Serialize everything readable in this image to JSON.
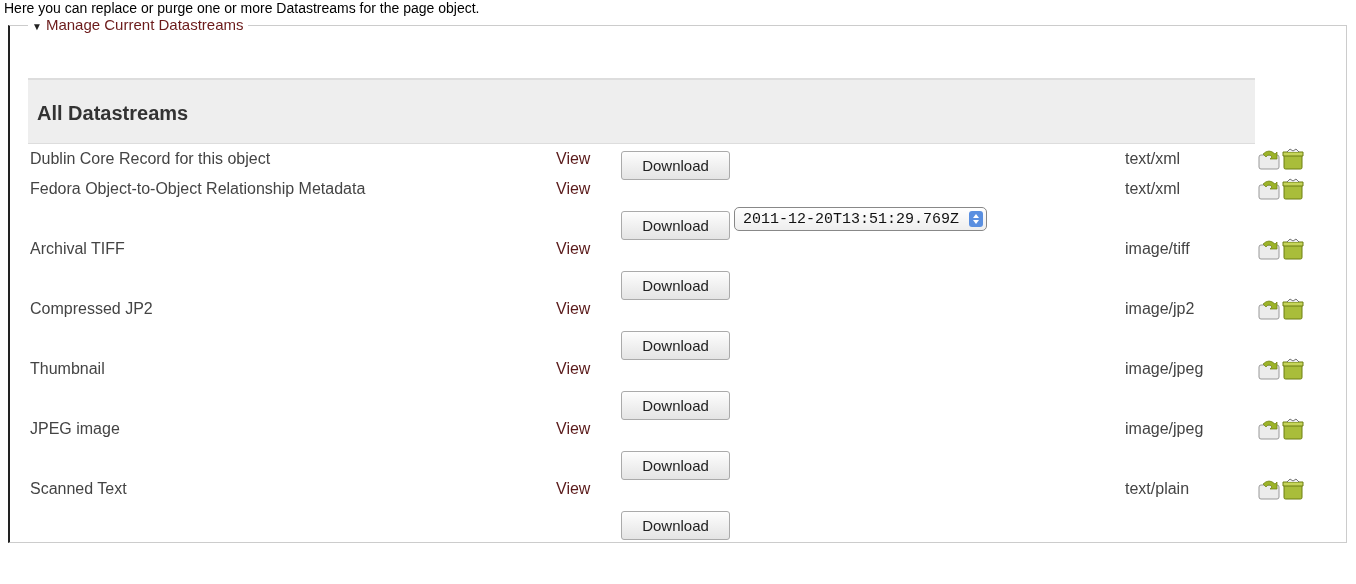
{
  "intro": "Here you can replace or purge one or more Datastreams for the page object.",
  "fieldset": {
    "toggle": "▼",
    "legend": "Manage Current Datastreams",
    "expanded": true
  },
  "heading": "All Datastreams",
  "rows": [
    {
      "kind": "inline",
      "label": "Dublin Core Record for this object",
      "view": "View",
      "download": "Download",
      "mime": "text/xml"
    },
    {
      "kind": "stacked",
      "label": "Fedora Object-to-Object Relationship Metadata",
      "view": "View",
      "download": "Download",
      "version": "2011-12-20T13:51:29.769Z",
      "mime": "text/xml"
    },
    {
      "kind": "stacked",
      "label": "Archival TIFF",
      "view": "View",
      "download": "Download",
      "mime": "image/tiff"
    },
    {
      "kind": "stacked",
      "label": "Compressed JP2",
      "view": "View",
      "download": "Download",
      "mime": "image/jp2"
    },
    {
      "kind": "stacked",
      "label": "Thumbnail",
      "view": "View",
      "download": "Download",
      "mime": "image/jpeg"
    },
    {
      "kind": "stacked",
      "label": "JPEG image",
      "view": "View",
      "download": "Download",
      "mime": "image/jpeg"
    },
    {
      "kind": "stacked",
      "label": "Scanned Text",
      "view": "View",
      "download": "Download",
      "mime": "text/plain"
    }
  ]
}
